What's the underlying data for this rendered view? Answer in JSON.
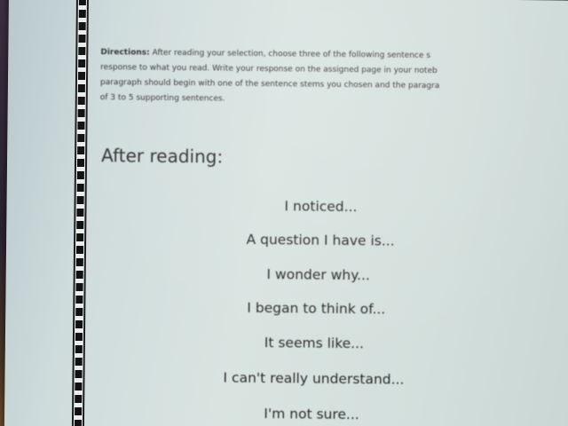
{
  "document": {
    "directions_label": "Directions:",
    "directions_lines": [
      "After reading your selection, choose three of the following sentence s",
      "response to what you read. Write your response on the assigned page in your noteb",
      "paragraph should begin with one of the sentence stems you chosen and the paragra",
      "of 3 to 5 supporting sentences."
    ],
    "heading": "After reading:",
    "sentence_stems": [
      "I noticed...",
      "A question I have is...",
      "I wonder why...",
      "I began to think of...",
      "It seems like...",
      "I can't really understand...",
      "I'm not sure..."
    ]
  },
  "colors": {
    "paper": "#d9e4e1",
    "text": "#2a2a2a",
    "film_border": "#111111"
  }
}
